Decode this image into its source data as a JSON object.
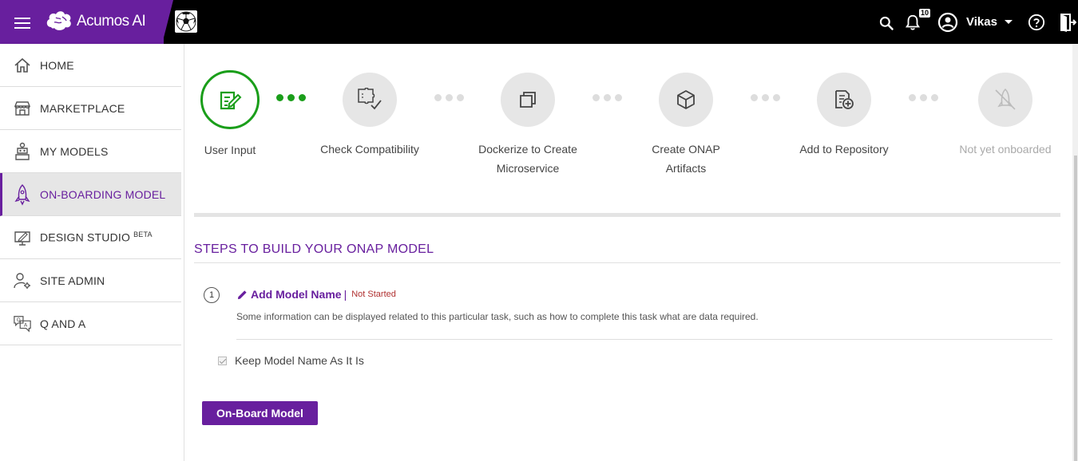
{
  "app": {
    "logo_text": "Acumos AI",
    "notification_count": "10",
    "user_name": "Vikas"
  },
  "sidebar": {
    "items": [
      {
        "label": "HOME",
        "icon": "home-icon"
      },
      {
        "label": "MARKETPLACE",
        "icon": "store-icon"
      },
      {
        "label": "MY MODELS",
        "icon": "robot-icon"
      },
      {
        "label": "ON-BOARDING MODEL",
        "icon": "rocket-icon",
        "active": true
      },
      {
        "label": "DESIGN STUDIO",
        "badge": "BETA",
        "icon": "monitor-pen-icon"
      },
      {
        "label": "SITE ADMIN",
        "icon": "user-gear-icon"
      },
      {
        "label": "Q AND A",
        "icon": "qa-chat-icon"
      }
    ]
  },
  "steps": [
    {
      "label": "User Input",
      "icon": "edit-note-icon",
      "state": "active"
    },
    {
      "label": "Check Compatibility",
      "icon": "puzzle-check-icon",
      "state": "pending"
    },
    {
      "label_line1": "Dockerize to Create",
      "label_line2": "Microservice",
      "icon": "copy-stack-icon",
      "state": "pending"
    },
    {
      "label_line1": "Create ONAP",
      "label_line2": "Artifacts",
      "icon": "cube-icon",
      "state": "pending"
    },
    {
      "label": "Add to Repository",
      "icon": "doc-add-icon",
      "state": "pending"
    },
    {
      "label": "Not yet onboarded",
      "icon": "rocket-off-icon",
      "state": "disabled"
    }
  ],
  "section": {
    "title": "STEPS TO BUILD YOUR ONAP MODEL"
  },
  "task": {
    "number": "1",
    "title": "Add Model Name",
    "separator": "|",
    "status": "Not Started",
    "description": "Some information can be displayed related to this particular task, such as how to complete this task what are data required.",
    "checkbox_label": "Keep Model Name As It Is",
    "checkbox_checked": true,
    "button_label": "On-Board Model"
  },
  "colors": {
    "brand": "#681f9e",
    "active_step": "#1a9e1a",
    "status_not_started": "#b03030"
  }
}
